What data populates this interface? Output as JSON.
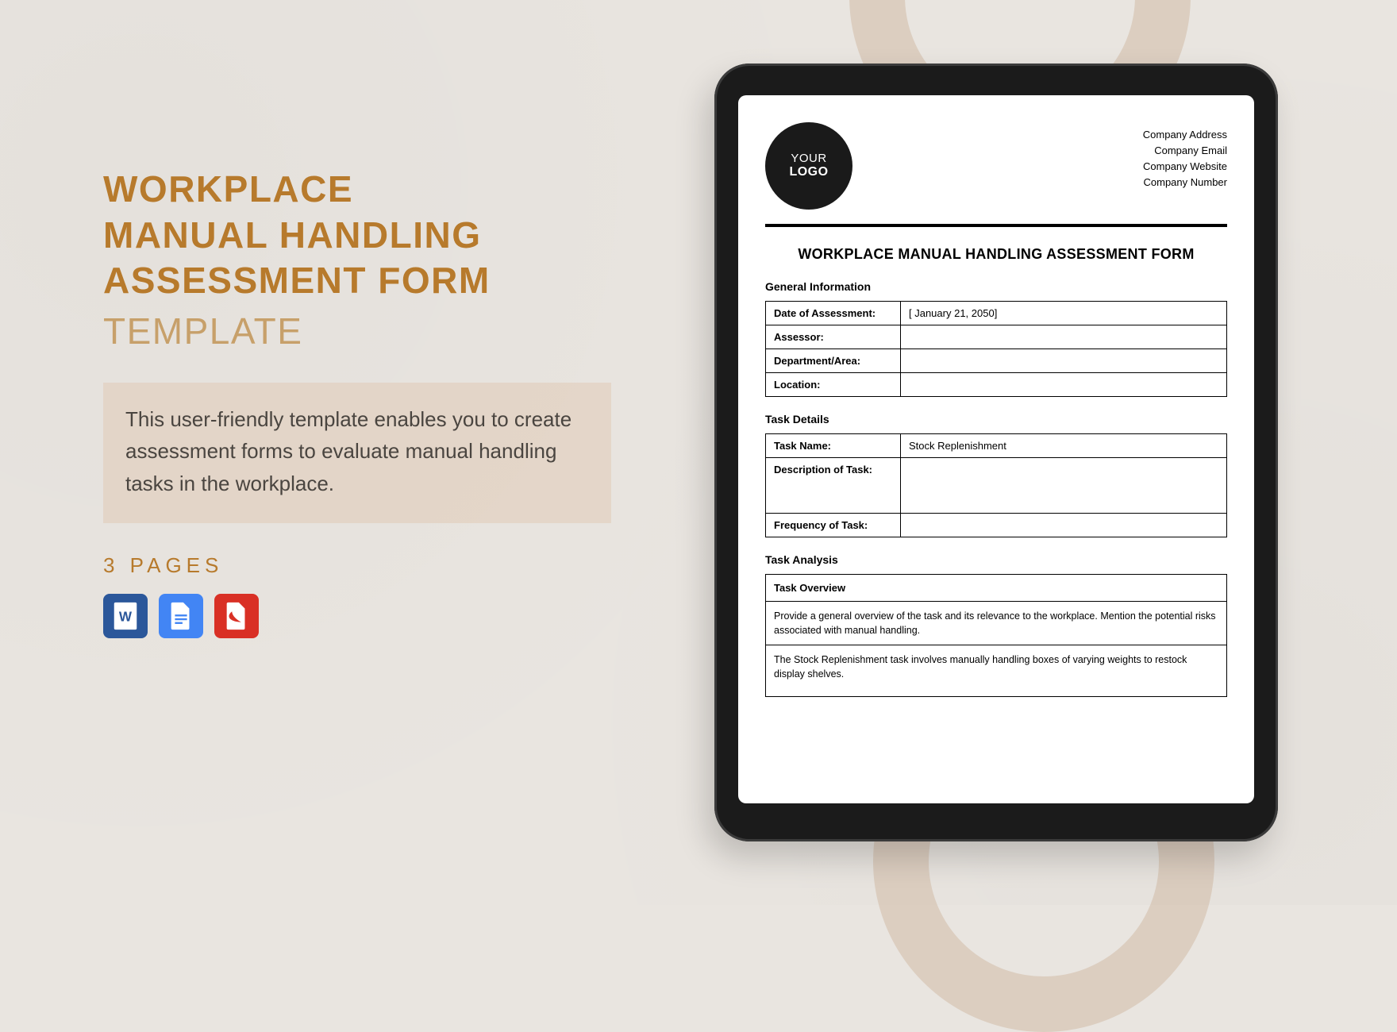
{
  "left": {
    "title_line1": "WORKPLACE",
    "title_line2": "MANUAL HANDLING",
    "title_line3": "ASSESSMENT FORM",
    "title_sub": "TEMPLATE",
    "description": "This user-friendly template enables you to create assessment forms to evaluate manual handling tasks in the workplace.",
    "pages_label": "3 PAGES"
  },
  "icons": {
    "word": "word-icon",
    "docs": "google-docs-icon",
    "pdf": "pdf-icon"
  },
  "doc": {
    "logo_line1": "YOUR",
    "logo_line2": "LOGO",
    "company": {
      "address": "Company Address",
      "email": "Company Email",
      "website": "Company Website",
      "number": "Company Number"
    },
    "title": "WORKPLACE MANUAL HANDLING ASSESSMENT FORM",
    "sections": {
      "general": {
        "heading": "General Information",
        "rows": {
          "date_label": "Date of Assessment:",
          "date_value": "[ January 21, 2050]",
          "assessor_label": "Assessor:",
          "assessor_value": "",
          "dept_label": "Department/Area:",
          "dept_value": "",
          "location_label": "Location:",
          "location_value": ""
        }
      },
      "task_details": {
        "heading": "Task Details",
        "rows": {
          "name_label": "Task Name:",
          "name_value": "Stock Replenishment",
          "desc_label": "Description of Task:",
          "desc_value": "",
          "freq_label": "Frequency of Task:",
          "freq_value": ""
        }
      },
      "task_analysis": {
        "heading": "Task Analysis",
        "overview_label": "Task Overview",
        "overview_prompt": "Provide a general overview of the task and its relevance to the workplace. Mention the potential risks associated with manual handling.",
        "overview_value": "The Stock Replenishment task involves manually handling boxes of varying weights to restock display shelves."
      }
    }
  }
}
